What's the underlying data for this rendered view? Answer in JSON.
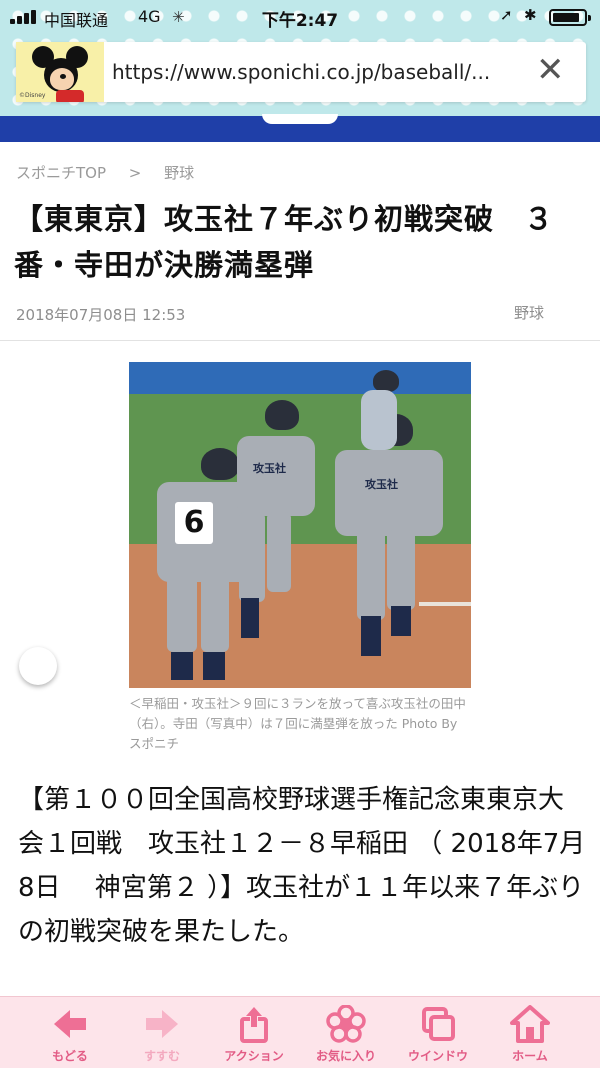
{
  "status_bar": {
    "carrier": "中国联通",
    "network": "4G",
    "time": "下午2:47"
  },
  "browser": {
    "url": "https://www.sponichi.co.jp/baseball/...",
    "mascot_label": "©Disney"
  },
  "breadcrumb": {
    "home": "スポニチTOP",
    "separator": ">",
    "section": "野球"
  },
  "article": {
    "headline": "【東東京】攻玉社７年ぶり初戦突破　３番・寺田が決勝満塁弾",
    "date": "2018年07月08日 12:53",
    "category": "野球",
    "photo": {
      "jersey_number": "6",
      "team_text": "攻玉社",
      "caption": "＜早稲田・攻玉社＞９回に３ランを放って喜ぶ攻玉社の田中（右）。寺田（写真中）は７回に満塁弾を放った Photo By スポニチ"
    },
    "body": "【第１００回全国高校野球選手権記念東東京大会１回戦　攻玉社１２－８早稲田 （ 2018年7月8日 　神宮第２ ）】攻玉社が１１年以来７年ぶりの初戦突破を果たした。"
  },
  "toolbar": {
    "items": [
      {
        "label": "もどる",
        "icon": "back-arrow-icon",
        "enabled": true
      },
      {
        "label": "すすむ",
        "icon": "forward-arrow-icon",
        "enabled": false
      },
      {
        "label": "アクション",
        "icon": "share-icon",
        "enabled": true
      },
      {
        "label": "お気に入り",
        "icon": "flower-icon",
        "enabled": true
      },
      {
        "label": "ウインドウ",
        "icon": "windows-icon",
        "enabled": true
      },
      {
        "label": "ホーム",
        "icon": "home-icon",
        "enabled": true
      }
    ]
  },
  "colors": {
    "header_bg": "#bfe8ea",
    "site_strip": "#1f3fa8",
    "toolbar_bg": "#fde4ea",
    "toolbar_accent": "#e25b85"
  }
}
